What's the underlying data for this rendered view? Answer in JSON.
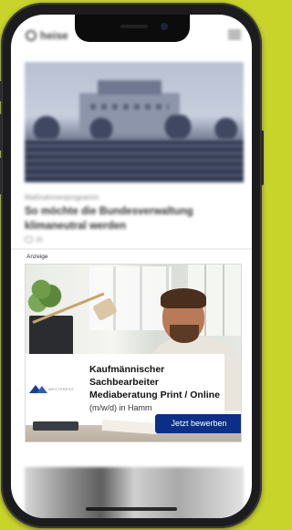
{
  "app": {
    "brand_text": "heise"
  },
  "article": {
    "kicker": "Maßnahmenprogramm",
    "headline": "So möchte die Bundesverwaltung klimaneutral werden",
    "comment_count": "26"
  },
  "ad": {
    "label": "Anzeige",
    "advertiser": "WESTPRESS",
    "job_title": "Kaufmännischer Sachbearbeiter Mediaberatung Print / Online",
    "job_meta": "(m/w/d) in Hamm",
    "cta_label": "Jetzt bewerben"
  },
  "colors": {
    "background": "#c8d42a",
    "cta": "#0b2f87",
    "brand": "#1b3d8f"
  }
}
